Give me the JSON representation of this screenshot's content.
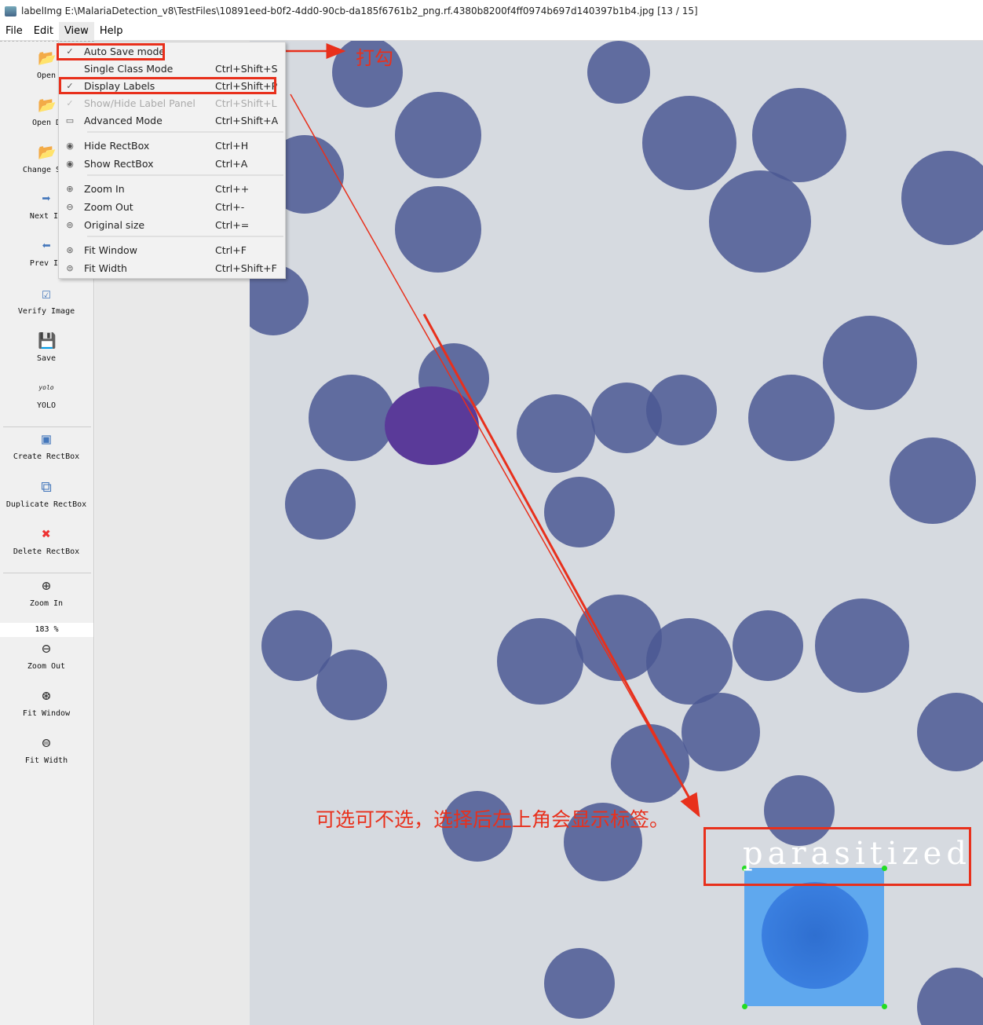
{
  "window": {
    "title": "labelImg E:\\MalariaDetection_v8\\TestFiles\\10891eed-b0f2-4dd0-90cb-da185f6761b2_png.rf.4380b8200f4ff0974b697d140397b1b4.jpg [13 / 15]"
  },
  "menubar": [
    "File",
    "Edit",
    "View",
    "Help"
  ],
  "toolbar": [
    {
      "label": "Open",
      "icon": "folder-icon"
    },
    {
      "label": "Open D",
      "icon": "folder-icon"
    },
    {
      "label": "Change Sav",
      "icon": "folder-icon"
    },
    {
      "label": "Next In",
      "icon": "arrow-right-icon"
    },
    {
      "label": "Prev In",
      "icon": "arrow-left-icon"
    },
    {
      "label": "Verify Image",
      "icon": "checkbox-icon"
    },
    {
      "label": "Save",
      "icon": "save-icon"
    },
    {
      "label": "YOLO",
      "icon": "yolo-icon",
      "icon_text": "yolo"
    },
    {
      "label": "Create RectBox",
      "icon": "create-rectbox-icon"
    },
    {
      "label": "Duplicate RectBox",
      "icon": "duplicate-icon"
    },
    {
      "label": "Delete RectBox",
      "icon": "delete-icon"
    },
    {
      "label": "Zoom In",
      "icon": "zoom-in-icon"
    },
    {
      "label": "Zoom Out",
      "icon": "zoom-out-icon"
    },
    {
      "label": "Fit Window",
      "icon": "fit-window-icon"
    },
    {
      "label": "Fit Width",
      "icon": "fit-width-icon"
    }
  ],
  "zoom_value": "183 %",
  "view_menu": [
    {
      "label": "Auto Save mode",
      "shortcut": "",
      "checked": true,
      "enabled": true
    },
    {
      "label": "Single Class Mode",
      "shortcut": "Ctrl+Shift+S",
      "checked": false,
      "enabled": true
    },
    {
      "label": "Display Labels",
      "shortcut": "Ctrl+Shift+P",
      "checked": true,
      "enabled": true
    },
    {
      "label": "Show/Hide Label Panel",
      "shortcut": "Ctrl+Shift+L",
      "checked": true,
      "enabled": false
    },
    {
      "label": "Advanced Mode",
      "shortcut": "Ctrl+Shift+A",
      "icon": "advanced-mode-icon",
      "enabled": true
    },
    {
      "label": "Hide RectBox",
      "shortcut": "Ctrl+H",
      "icon": "eye-icon",
      "enabled": true
    },
    {
      "label": "Show RectBox",
      "shortcut": "Ctrl+A",
      "icon": "eye-icon",
      "enabled": true
    },
    {
      "label": "Zoom In",
      "shortcut": "Ctrl++",
      "icon": "zoom-in-icon",
      "enabled": true
    },
    {
      "label": "Zoom Out",
      "shortcut": "Ctrl+-",
      "icon": "zoom-out-icon",
      "enabled": true
    },
    {
      "label": "Original size",
      "shortcut": "Ctrl+=",
      "icon": "original-size-icon",
      "enabled": true
    },
    {
      "label": "Fit Window",
      "shortcut": "Ctrl+F",
      "icon": "fit-window-icon",
      "enabled": true
    },
    {
      "label": "Fit Width",
      "shortcut": "Ctrl+Shift+F",
      "icon": "fit-width-icon",
      "enabled": true
    }
  ],
  "annotations": {
    "check_note": "打勾",
    "labels_note": "可选可不选，选择后左上角会显示标签。",
    "color": "#e8301c"
  },
  "bbox": {
    "label": "parasitized",
    "fill": "#4a9ff0",
    "handle_color": "#22dd22"
  }
}
